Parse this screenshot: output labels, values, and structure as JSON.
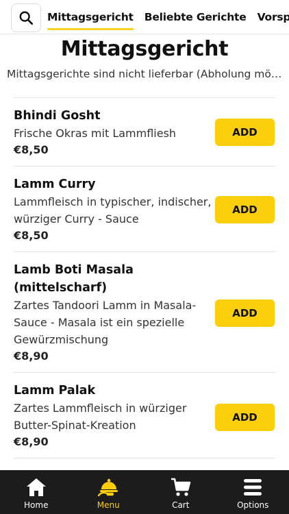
{
  "header": {
    "search_icon": "search-icon",
    "tabs": [
      {
        "label": "Mittagsgericht",
        "active": true
      },
      {
        "label": "Beliebte Gerichte",
        "active": false
      },
      {
        "label": "Vorspeisen",
        "active": false
      }
    ]
  },
  "section": {
    "title": "Mittagsgericht",
    "subtitle": "Mittagsgerichte sind nicht lieferbar (Abholung möglich)"
  },
  "items": [
    {
      "name": "Bhindi Gosht",
      "description": "Frische Okras mit Lammfliesh",
      "price": "€8,50",
      "add_label": "ADD"
    },
    {
      "name": "Lamm Curry",
      "description": "Lammfleisch in typischer, indischer, würziger Curry - Sauce",
      "price": "€8,50",
      "add_label": "ADD"
    },
    {
      "name": "Lamb Boti Masala (mittelscharf)",
      "description": "Zartes Tandoori Lamm in Masala-Sauce - Masala ist ein spezielle Gewürzmischung",
      "price": "€8,90",
      "add_label": "ADD"
    },
    {
      "name": "Lamm Palak",
      "description": "Zartes Lammfleisch in würziger Butter-Spinat-Kreation",
      "price": "€8,90",
      "add_label": "ADD"
    }
  ],
  "bottom_nav": {
    "items": [
      {
        "label": "Home",
        "icon": "home-icon",
        "active": false
      },
      {
        "label": "Menu",
        "icon": "menu-cloche-icon",
        "active": true
      },
      {
        "label": "Cart",
        "icon": "cart-icon",
        "active": false
      },
      {
        "label": "Options",
        "icon": "hamburger-icon",
        "active": false
      }
    ]
  },
  "colors": {
    "accent": "#fccf0c",
    "nav_bg": "#1c1c1c"
  }
}
